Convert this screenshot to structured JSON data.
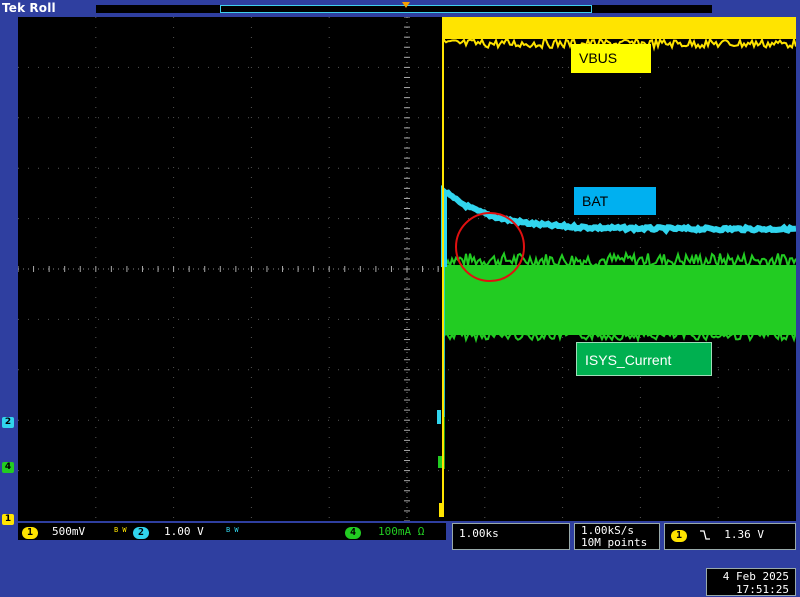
{
  "header": {
    "brand": "Tek",
    "mode": "Roll"
  },
  "labels": {
    "vbus": "VBUS",
    "bat": "BAT",
    "isys": "ISYS_Current"
  },
  "channel_markers": {
    "ch1": "1",
    "ch2": "2",
    "ch4": "4"
  },
  "status": {
    "ch1": {
      "number": "1",
      "scale": "500mV",
      "bw": "B W"
    },
    "ch2": {
      "number": "2",
      "scale": "1.00 V",
      "bw": "B W"
    },
    "ch4": {
      "number": "4",
      "scale": "100mA Ω"
    }
  },
  "timebase": "1.00ks",
  "sample_rate": "1.00kS/s",
  "record_length": "10M points",
  "trigger": {
    "channel": "1",
    "slope": "falling-edge-icon",
    "level": "1.36 V"
  },
  "date": "4 Feb 2025",
  "time": "17:51:25",
  "colors": {
    "ch1": "#ffe400",
    "ch2": "#31d5ee",
    "ch4": "#22cc22",
    "frame": "#2f3fa0",
    "highlight_circle": "#e01010"
  }
}
